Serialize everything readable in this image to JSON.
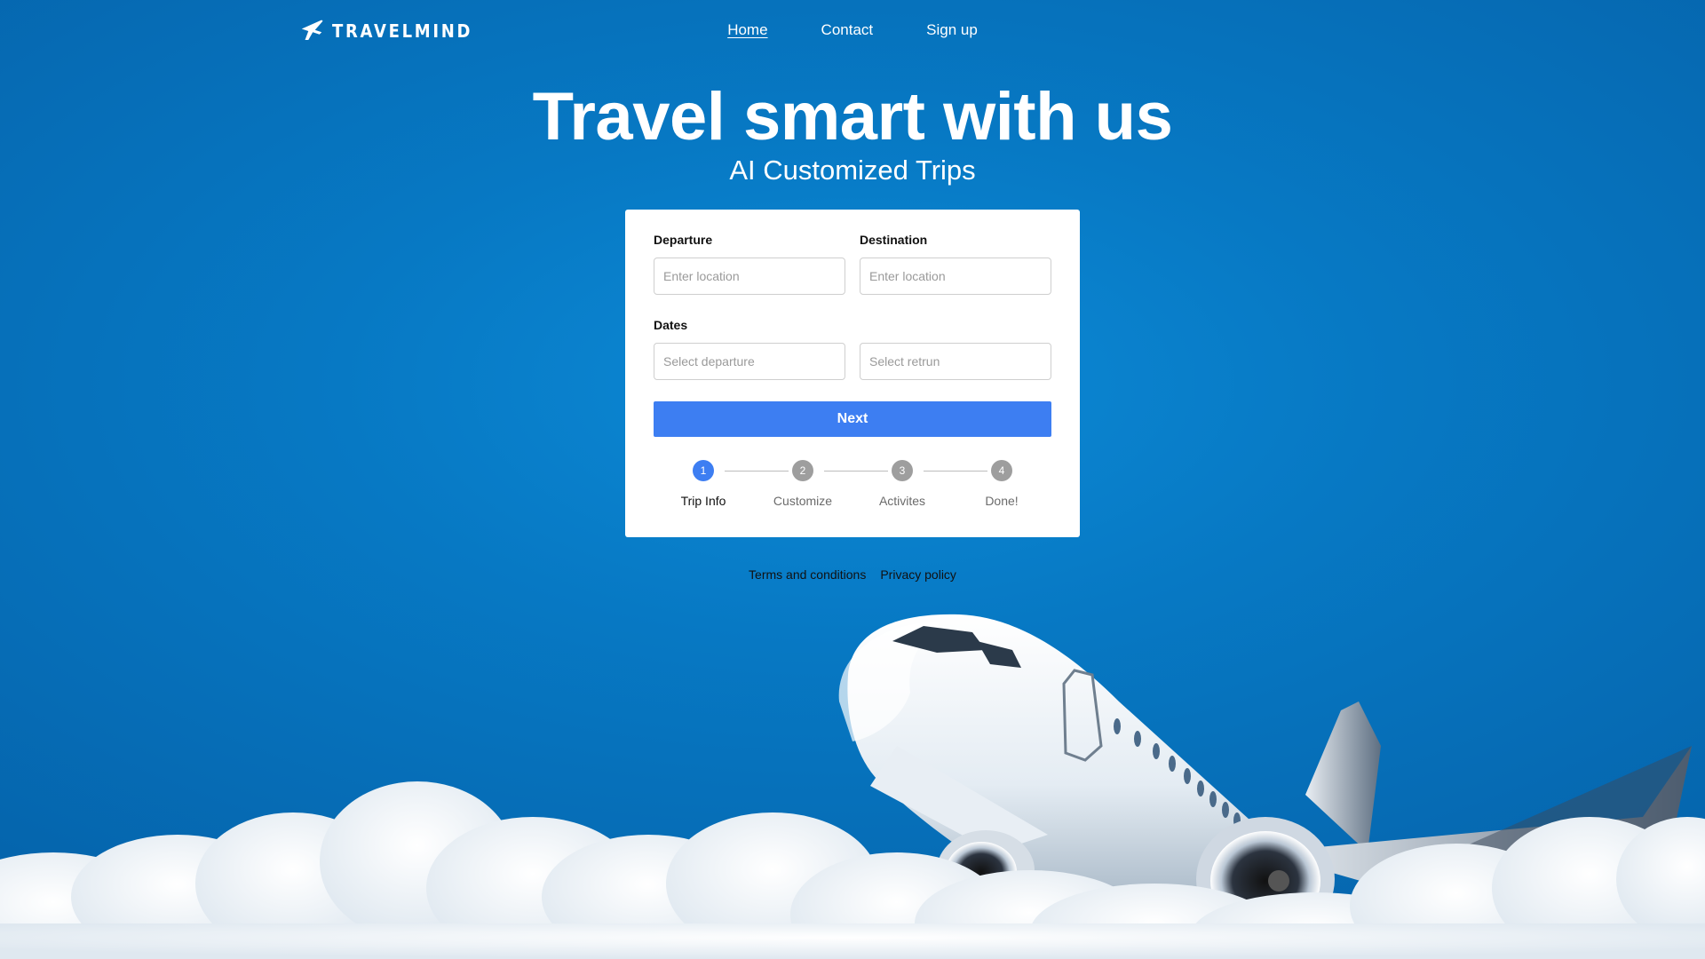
{
  "brand": {
    "name": "TRAVELMIND",
    "icon": "airplane-icon"
  },
  "nav": {
    "items": [
      "Home",
      "Contact",
      "Sign up"
    ],
    "active": "Home"
  },
  "hero": {
    "title": "Travel smart with us",
    "subtitle": "AI Customized Trips"
  },
  "form": {
    "departure": {
      "label": "Departure",
      "placeholder": "Enter location",
      "value": ""
    },
    "destination": {
      "label": "Destination",
      "placeholder": "Enter location",
      "value": ""
    },
    "dates": {
      "label": "Dates",
      "departure_placeholder": "Select departure",
      "return_placeholder": "Select retrun"
    },
    "next_label": "Next"
  },
  "stepper": {
    "current": 1,
    "steps": [
      {
        "number": "1",
        "label": "Trip Info"
      },
      {
        "number": "2",
        "label": "Customize"
      },
      {
        "number": "3",
        "label": "Activites"
      },
      {
        "number": "4",
        "label": "Done!"
      }
    ]
  },
  "footer": {
    "links": [
      "Terms and conditions",
      "Privacy policy"
    ]
  },
  "colors": {
    "accent": "#3d7ef2",
    "background": "#0779c4",
    "inactive_step": "#9e9e9e"
  }
}
